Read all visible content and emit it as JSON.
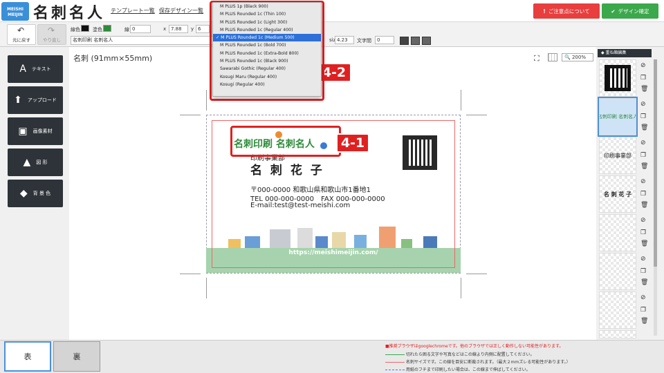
{
  "header": {
    "logo_badge": "MEISHI MEIJIN",
    "logo_text": "名刺名人",
    "links": [
      "テンプレート一覧",
      "保存デザイン一覧"
    ],
    "caution_button": "ご注意点について",
    "confirm_button": "デザイン確定"
  },
  "toolbar": {
    "undo": "元に戻す",
    "redo": "やり直し",
    "line_color_label": "線色",
    "fill_color_label": "塗色",
    "line_color": "#111111",
    "fill_color": "#2e8b3a",
    "line_label": "線",
    "line_value": "0",
    "x_label": "x",
    "x_value": "7.88",
    "y_label": "y",
    "y_value": "6",
    "text_value": "名刺印刷 名刺名人",
    "size_label": "size",
    "size_value": "4.23",
    "spacing_label": "文字間",
    "spacing_value": "0"
  },
  "tools": [
    "テキスト",
    "アップロード",
    "画像素材",
    "図 形",
    "背 景 色"
  ],
  "canvas": {
    "card_title": "名刺 (91mm×55mm)",
    "zoom": "200%"
  },
  "card": {
    "company": "名刺印刷 名刺名人",
    "dept": "印刷事業部",
    "name": "名 刺 花 子",
    "address": "〒000-0000 和歌山県和歌山市1番地1",
    "phone": "TEL 000-000-0000　FAX 000-000-0000",
    "email": "E-mail:test@test-meishi.com",
    "url": "https://meishimeijin.com/"
  },
  "font_dropdown": {
    "items": [
      "M PLUS 1p (Black 900)",
      "M PLUS Rounded 1c (Thin 100)",
      "M PLUS Rounded 1c (Light 300)",
      "M PLUS Rounded 1c (Regular 400)",
      "M PLUS Rounded 1c (Medium 500)",
      "M PLUS Rounded 1c (Bold 700)",
      "M PLUS Rounded 1c (Extra-Bold 800)",
      "M PLUS Rounded 1c (Black 900)",
      "Sawarabi Gothic (Regular 400)",
      "Kosugi Maru (Regular 400)",
      "Kosugi (Regular 400)"
    ],
    "selected_index": 4
  },
  "badges": {
    "step1": "4-1",
    "step2": "4-2"
  },
  "layers": {
    "header": "重ね順編集",
    "items": [
      "",
      "名刺印刷 名刺名人",
      "印刷事業部",
      "名 刺 花 子",
      "",
      "",
      "",
      ""
    ]
  },
  "bottom": {
    "front": "表",
    "back": "裏",
    "notes": [
      "■推奨ブラウザはgooglechromeです。他のブラウザでは正しく動作しない可能性があります。",
      "切れたら困る文字や写真などはこの線より内側に配置してください。",
      "名刺サイズです。この線を目安に断裁されます。（最大２mmズレる可能性があります。）",
      "用紙のフチまで印刷したい場合は、この線まで伸ばしてください。"
    ]
  },
  "colors": {
    "accent_red": "#e02020",
    "green": "#3ba84b",
    "tool_dark": "#2d3338"
  }
}
